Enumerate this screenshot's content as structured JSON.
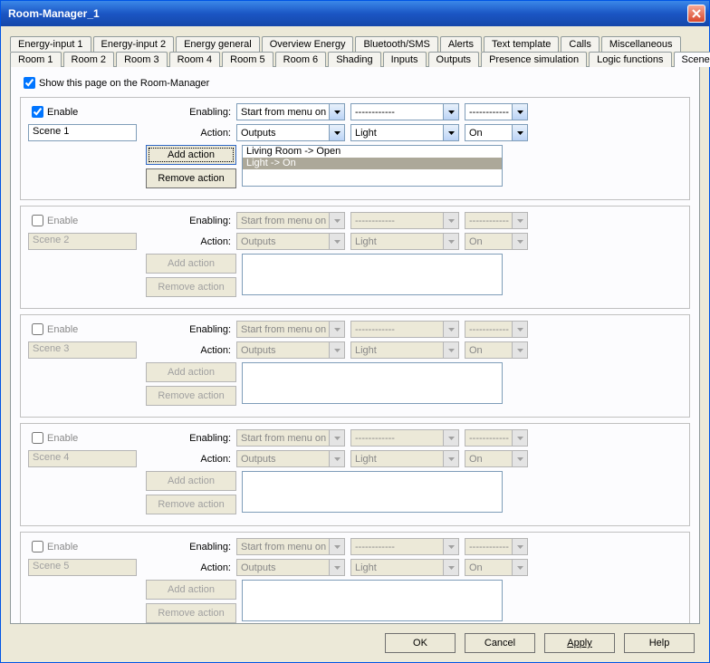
{
  "window": {
    "title": "Room-Manager_1"
  },
  "tabrow1": [
    "Energy-input 1",
    "Energy-input 2",
    "Energy general",
    "Overview Energy",
    "Bluetooth/SMS",
    "Alerts",
    "Text template",
    "Calls",
    "Miscellaneous"
  ],
  "tabrow2": [
    "Room 1",
    "Room 2",
    "Room 3",
    "Room 4",
    "Room 5",
    "Room 6",
    "Shading",
    "Inputs",
    "Outputs",
    "Presence simulation",
    "Logic functions",
    "Scenes"
  ],
  "active_tab": "Scenes",
  "show_page_label": "Show this page on the Room-Manager",
  "labels": {
    "enable": "Enable",
    "enabling": "Enabling:",
    "action": "Action:",
    "add_action": "Add action",
    "remove_action": "Remove action",
    "dashed": "------------"
  },
  "scenes": [
    {
      "enabled": true,
      "name": "Scene 1",
      "enabling_sel": "Start from menu on",
      "enabling_b": "------------",
      "enabling_c": "------------",
      "action_a": "Outputs",
      "action_b": "Light",
      "action_c": "On",
      "list": [
        "Living Room -> Open",
        "Light -> On"
      ],
      "selected_idx": 1
    },
    {
      "enabled": false,
      "name": "Scene 2",
      "enabling_sel": "Start from menu on",
      "enabling_b": "------------",
      "enabling_c": "------------",
      "action_a": "Outputs",
      "action_b": "Light",
      "action_c": "On",
      "list": [],
      "selected_idx": -1
    },
    {
      "enabled": false,
      "name": "Scene 3",
      "enabling_sel": "Start from menu on",
      "enabling_b": "------------",
      "enabling_c": "------------",
      "action_a": "Outputs",
      "action_b": "Light",
      "action_c": "On",
      "list": [],
      "selected_idx": -1
    },
    {
      "enabled": false,
      "name": "Scene 4",
      "enabling_sel": "Start from menu on",
      "enabling_b": "------------",
      "enabling_c": "------------",
      "action_a": "Outputs",
      "action_b": "Light",
      "action_c": "On",
      "list": [],
      "selected_idx": -1
    },
    {
      "enabled": false,
      "name": "Scene 5",
      "enabling_sel": "Start from menu on",
      "enabling_b": "------------",
      "enabling_c": "------------",
      "action_a": "Outputs",
      "action_b": "Light",
      "action_c": "On",
      "list": [],
      "selected_idx": -1
    }
  ],
  "footer": {
    "ok": "OK",
    "cancel": "Cancel",
    "apply": "Apply",
    "help": "Help"
  }
}
